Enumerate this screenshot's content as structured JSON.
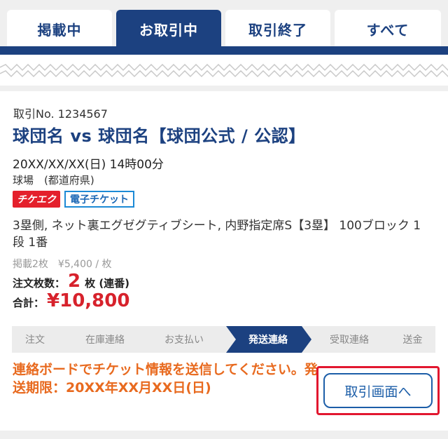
{
  "tabs": [
    {
      "label": "掲載中",
      "active": false
    },
    {
      "label": "お取引中",
      "active": true
    },
    {
      "label": "取引終了",
      "active": false
    },
    {
      "label": "すべて",
      "active": false
    }
  ],
  "transaction": {
    "number": "取引No. 1234567",
    "title": "球団名 vs 球団名【球団公式 / 公認】",
    "datetime": "20XX/XX/XX(日) 14時00分",
    "venue": "球場　(都道府県)",
    "badges": {
      "ticket_check": "チケエク",
      "e_ticket": "電子チケット"
    },
    "seat": "3塁側, ネット裏エグゼグティブシート, 内野指定席S【3塁】 100ブロック 1段 1番",
    "listing": "掲載2枚　¥5,400 / 枚",
    "quantity": {
      "label": "注文枚数：",
      "value": "2",
      "unit": "枚 (連番)"
    },
    "total": {
      "label": "合計：",
      "value": "¥10,800"
    }
  },
  "steps": [
    {
      "label": "注文",
      "active": false
    },
    {
      "label": "在庫連絡",
      "active": false
    },
    {
      "label": "お支払い",
      "active": false
    },
    {
      "label": "発送連絡",
      "active": true
    },
    {
      "label": "受取連絡",
      "active": false
    },
    {
      "label": "送金",
      "active": false
    }
  ],
  "notice": "連絡ボードでチケット情報を送信してください。発送期限：20XX年XX月XX日(日)",
  "action_button": "取引画面へ",
  "colors": {
    "brand": "#1c4180",
    "accent_red": "#d7222c",
    "notice_orange": "#e86a1f"
  }
}
